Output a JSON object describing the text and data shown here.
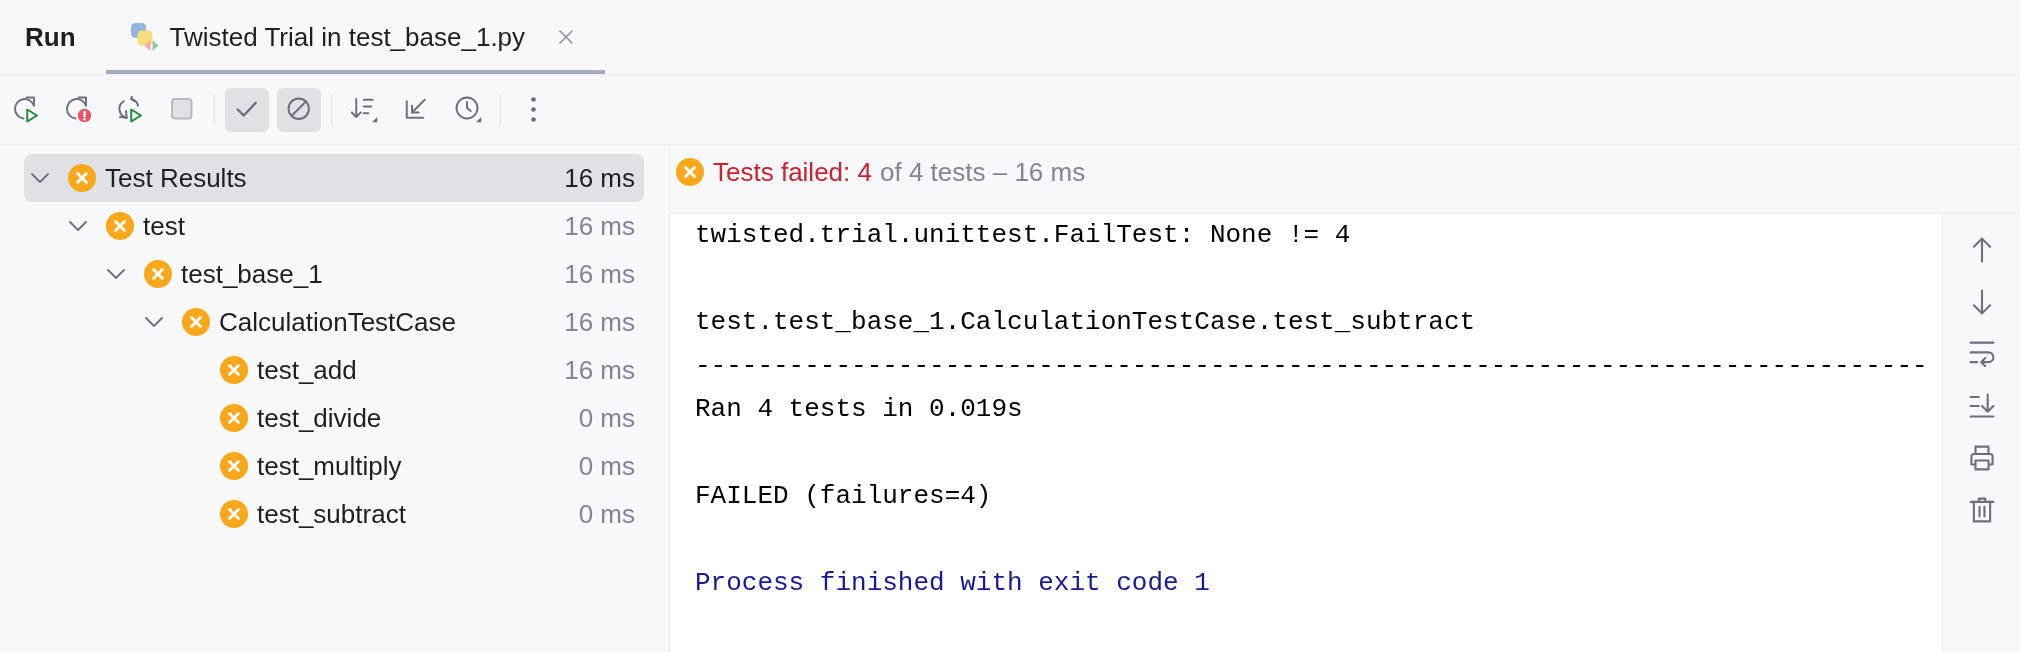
{
  "tool_window": {
    "title": "Run"
  },
  "tabs": [
    {
      "label": "Twisted Trial in test_base_1.py",
      "selected": true,
      "closable": true
    }
  ],
  "toolbar": [
    {
      "buttons": [
        {
          "kind": "rerun",
          "on": false,
          "disabled": false
        },
        {
          "kind": "rerunfailed",
          "on": false,
          "disabled": false
        },
        {
          "kind": "autorerun",
          "on": false,
          "disabled": false
        },
        {
          "kind": "stop",
          "on": false,
          "disabled": true
        }
      ]
    },
    {
      "buttons": [
        {
          "kind": "passed",
          "on": true,
          "disabled": false
        },
        {
          "kind": "ignored",
          "on": true,
          "disabled": false
        }
      ]
    },
    {
      "buttons": [
        {
          "kind": "sort",
          "on": false,
          "disabled": false
        },
        {
          "kind": "collapse",
          "on": false,
          "disabled": false
        },
        {
          "kind": "history",
          "on": false,
          "disabled": false
        }
      ]
    },
    {
      "buttons": [
        {
          "kind": "more",
          "on": false,
          "disabled": false
        }
      ]
    }
  ],
  "tree": [
    {
      "label": "Test Results",
      "time": "16 ms",
      "failed": true,
      "expanded": true,
      "selected": true,
      "children": [
        {
          "label": "test",
          "time": "16 ms",
          "failed": true,
          "expanded": true,
          "selected": false,
          "children": [
            {
              "label": "test_base_1",
              "time": "16 ms",
              "failed": true,
              "expanded": true,
              "selected": false,
              "children": [
                {
                  "label": "CalculationTestCase",
                  "time": "16 ms",
                  "failed": true,
                  "expanded": true,
                  "selected": false,
                  "children": [
                    {
                      "label": "test_add",
                      "time": "16 ms",
                      "failed": true,
                      "selected": false
                    },
                    {
                      "label": "test_divide",
                      "time": "0 ms",
                      "failed": true,
                      "selected": false
                    },
                    {
                      "label": "test_multiply",
                      "time": "0 ms",
                      "failed": true,
                      "selected": false
                    },
                    {
                      "label": "test_subtract",
                      "time": "0 ms",
                      "failed": true,
                      "selected": false
                    }
                  ]
                }
              ]
            }
          ]
        }
      ]
    }
  ],
  "summary": {
    "failed": true,
    "failed_text": "Tests failed: 4",
    "detail": "of 4 tests – 16 ms"
  },
  "console": {
    "blocks": [
      {
        "kind": "output",
        "lines": [
          "twisted.trial.unittest.FailTest: None != 4"
        ]
      },
      {
        "kind": "output",
        "lines": [
          "test.test_base_1.CalculationTestCase.test_subtract",
          "-------------------------------------------------------------------------------",
          "Ran 4 tests in 0.019s"
        ]
      },
      {
        "kind": "output",
        "lines": [
          "FAILED (failures=4)"
        ]
      },
      {
        "kind": "system",
        "lines": [
          "Process finished with exit code 1"
        ]
      }
    ]
  }
}
